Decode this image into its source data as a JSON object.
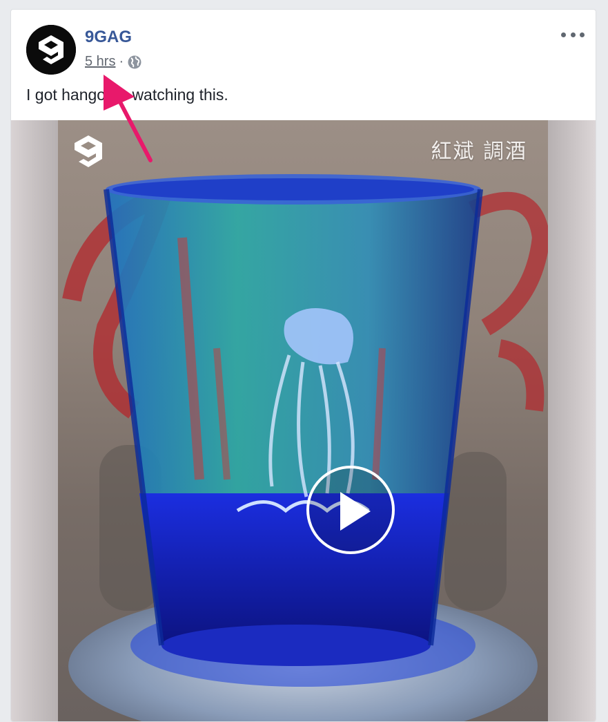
{
  "post": {
    "page_name": "9GAG",
    "timestamp": "5 hrs",
    "separator": "·",
    "privacy_icon": "globe-icon",
    "text": "I got hangover watching this.",
    "more_icon": "more-options-icon"
  },
  "video": {
    "caption": "紅斌 調酒",
    "watermark": "9gag-logo",
    "play_icon": "play-icon"
  },
  "colors": {
    "link_blue": "#385898",
    "meta_gray": "#616770",
    "annotation_pink": "#e8196b",
    "liquid_blue": "#1a2fd0"
  }
}
